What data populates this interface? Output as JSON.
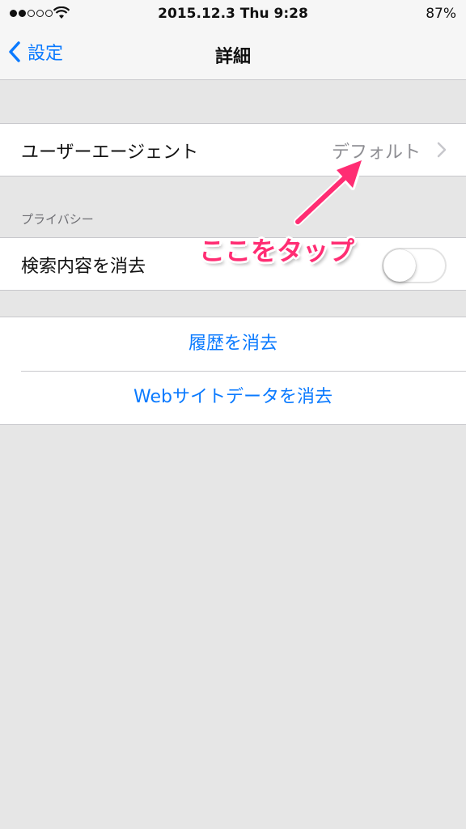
{
  "status_bar": {
    "time": "2015.12.3 Thu 9:28",
    "battery": "87%",
    "signal_bars_filled": 2,
    "signal_bars_total": 5
  },
  "nav": {
    "back_label": "設定",
    "title": "詳細"
  },
  "user_agent": {
    "label": "ユーザーエージェント",
    "value": "デフォルト"
  },
  "privacy": {
    "header": "プライバシー",
    "search_clear_label": "検索内容を消去",
    "search_clear_enabled": false
  },
  "actions": {
    "clear_history": "履歴を消去",
    "clear_website_data": "Webサイトデータを消去"
  },
  "annotation": {
    "text": "ここをタップ",
    "color": "#ff2d73"
  },
  "colors": {
    "accent": "#0a7aff",
    "background": "#e6e6e6"
  }
}
